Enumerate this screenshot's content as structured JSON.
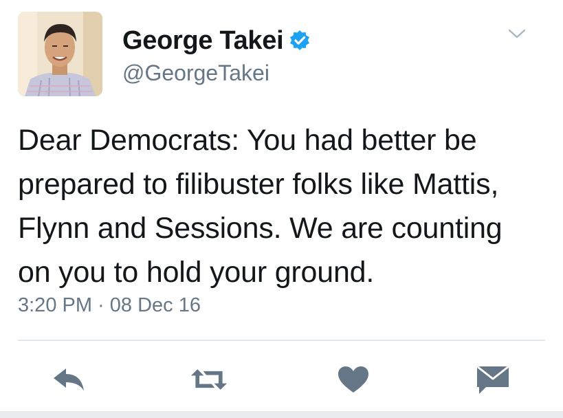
{
  "author": {
    "display_name": "George Takei",
    "handle": "@GeorgeTakei",
    "verified": true,
    "avatar_icon": "profile-photo"
  },
  "tweet": {
    "text_lines": [
      "Dear Democrats: You had better be",
      "prepared to filibuster folks like Mattis,",
      "Flynn and Sessions. We are counting",
      "on you to hold your ground."
    ],
    "timestamp": "3:20 PM · 08 Dec 16"
  },
  "actions": [
    {
      "name": "reply",
      "icon": "reply-icon"
    },
    {
      "name": "retweet",
      "icon": "retweet-icon"
    },
    {
      "name": "like",
      "icon": "heart-icon"
    },
    {
      "name": "direct-message",
      "icon": "envelope-icon"
    }
  ],
  "colors": {
    "text": "#14171a",
    "secondary": "#657786",
    "verified": "#1da1f2",
    "icon": "#657786",
    "divider": "#e1e8ed"
  }
}
